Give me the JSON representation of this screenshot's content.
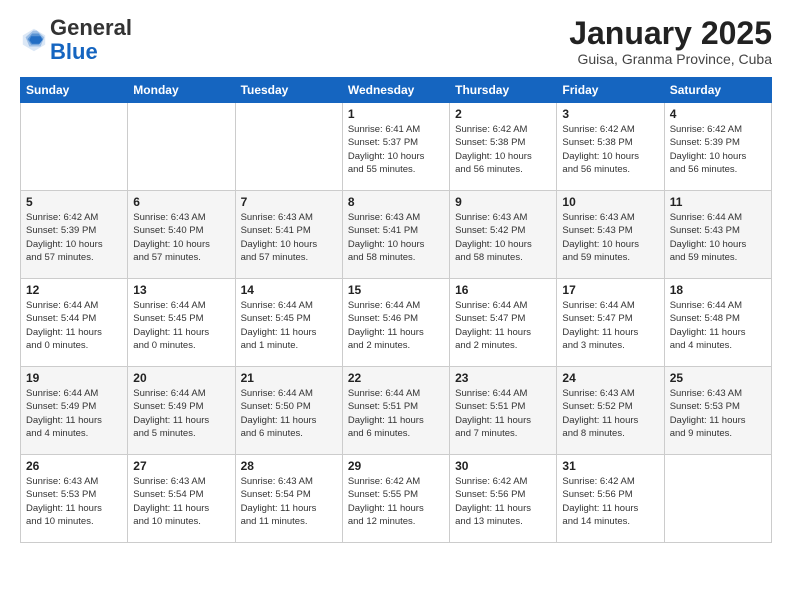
{
  "header": {
    "logo_general": "General",
    "logo_blue": "Blue",
    "title": "January 2025",
    "subtitle": "Guisa, Granma Province, Cuba"
  },
  "days_of_week": [
    "Sunday",
    "Monday",
    "Tuesday",
    "Wednesday",
    "Thursday",
    "Friday",
    "Saturday"
  ],
  "weeks": [
    [
      {
        "day": "",
        "info": ""
      },
      {
        "day": "",
        "info": ""
      },
      {
        "day": "",
        "info": ""
      },
      {
        "day": "1",
        "info": "Sunrise: 6:41 AM\nSunset: 5:37 PM\nDaylight: 10 hours\nand 55 minutes."
      },
      {
        "day": "2",
        "info": "Sunrise: 6:42 AM\nSunset: 5:38 PM\nDaylight: 10 hours\nand 56 minutes."
      },
      {
        "day": "3",
        "info": "Sunrise: 6:42 AM\nSunset: 5:38 PM\nDaylight: 10 hours\nand 56 minutes."
      },
      {
        "day": "4",
        "info": "Sunrise: 6:42 AM\nSunset: 5:39 PM\nDaylight: 10 hours\nand 56 minutes."
      }
    ],
    [
      {
        "day": "5",
        "info": "Sunrise: 6:42 AM\nSunset: 5:39 PM\nDaylight: 10 hours\nand 57 minutes."
      },
      {
        "day": "6",
        "info": "Sunrise: 6:43 AM\nSunset: 5:40 PM\nDaylight: 10 hours\nand 57 minutes."
      },
      {
        "day": "7",
        "info": "Sunrise: 6:43 AM\nSunset: 5:41 PM\nDaylight: 10 hours\nand 57 minutes."
      },
      {
        "day": "8",
        "info": "Sunrise: 6:43 AM\nSunset: 5:41 PM\nDaylight: 10 hours\nand 58 minutes."
      },
      {
        "day": "9",
        "info": "Sunrise: 6:43 AM\nSunset: 5:42 PM\nDaylight: 10 hours\nand 58 minutes."
      },
      {
        "day": "10",
        "info": "Sunrise: 6:43 AM\nSunset: 5:43 PM\nDaylight: 10 hours\nand 59 minutes."
      },
      {
        "day": "11",
        "info": "Sunrise: 6:44 AM\nSunset: 5:43 PM\nDaylight: 10 hours\nand 59 minutes."
      }
    ],
    [
      {
        "day": "12",
        "info": "Sunrise: 6:44 AM\nSunset: 5:44 PM\nDaylight: 11 hours\nand 0 minutes."
      },
      {
        "day": "13",
        "info": "Sunrise: 6:44 AM\nSunset: 5:45 PM\nDaylight: 11 hours\nand 0 minutes."
      },
      {
        "day": "14",
        "info": "Sunrise: 6:44 AM\nSunset: 5:45 PM\nDaylight: 11 hours\nand 1 minute."
      },
      {
        "day": "15",
        "info": "Sunrise: 6:44 AM\nSunset: 5:46 PM\nDaylight: 11 hours\nand 2 minutes."
      },
      {
        "day": "16",
        "info": "Sunrise: 6:44 AM\nSunset: 5:47 PM\nDaylight: 11 hours\nand 2 minutes."
      },
      {
        "day": "17",
        "info": "Sunrise: 6:44 AM\nSunset: 5:47 PM\nDaylight: 11 hours\nand 3 minutes."
      },
      {
        "day": "18",
        "info": "Sunrise: 6:44 AM\nSunset: 5:48 PM\nDaylight: 11 hours\nand 4 minutes."
      }
    ],
    [
      {
        "day": "19",
        "info": "Sunrise: 6:44 AM\nSunset: 5:49 PM\nDaylight: 11 hours\nand 4 minutes."
      },
      {
        "day": "20",
        "info": "Sunrise: 6:44 AM\nSunset: 5:49 PM\nDaylight: 11 hours\nand 5 minutes."
      },
      {
        "day": "21",
        "info": "Sunrise: 6:44 AM\nSunset: 5:50 PM\nDaylight: 11 hours\nand 6 minutes."
      },
      {
        "day": "22",
        "info": "Sunrise: 6:44 AM\nSunset: 5:51 PM\nDaylight: 11 hours\nand 6 minutes."
      },
      {
        "day": "23",
        "info": "Sunrise: 6:44 AM\nSunset: 5:51 PM\nDaylight: 11 hours\nand 7 minutes."
      },
      {
        "day": "24",
        "info": "Sunrise: 6:43 AM\nSunset: 5:52 PM\nDaylight: 11 hours\nand 8 minutes."
      },
      {
        "day": "25",
        "info": "Sunrise: 6:43 AM\nSunset: 5:53 PM\nDaylight: 11 hours\nand 9 minutes."
      }
    ],
    [
      {
        "day": "26",
        "info": "Sunrise: 6:43 AM\nSunset: 5:53 PM\nDaylight: 11 hours\nand 10 minutes."
      },
      {
        "day": "27",
        "info": "Sunrise: 6:43 AM\nSunset: 5:54 PM\nDaylight: 11 hours\nand 10 minutes."
      },
      {
        "day": "28",
        "info": "Sunrise: 6:43 AM\nSunset: 5:54 PM\nDaylight: 11 hours\nand 11 minutes."
      },
      {
        "day": "29",
        "info": "Sunrise: 6:42 AM\nSunset: 5:55 PM\nDaylight: 11 hours\nand 12 minutes."
      },
      {
        "day": "30",
        "info": "Sunrise: 6:42 AM\nSunset: 5:56 PM\nDaylight: 11 hours\nand 13 minutes."
      },
      {
        "day": "31",
        "info": "Sunrise: 6:42 AM\nSunset: 5:56 PM\nDaylight: 11 hours\nand 14 minutes."
      },
      {
        "day": "",
        "info": ""
      }
    ]
  ]
}
